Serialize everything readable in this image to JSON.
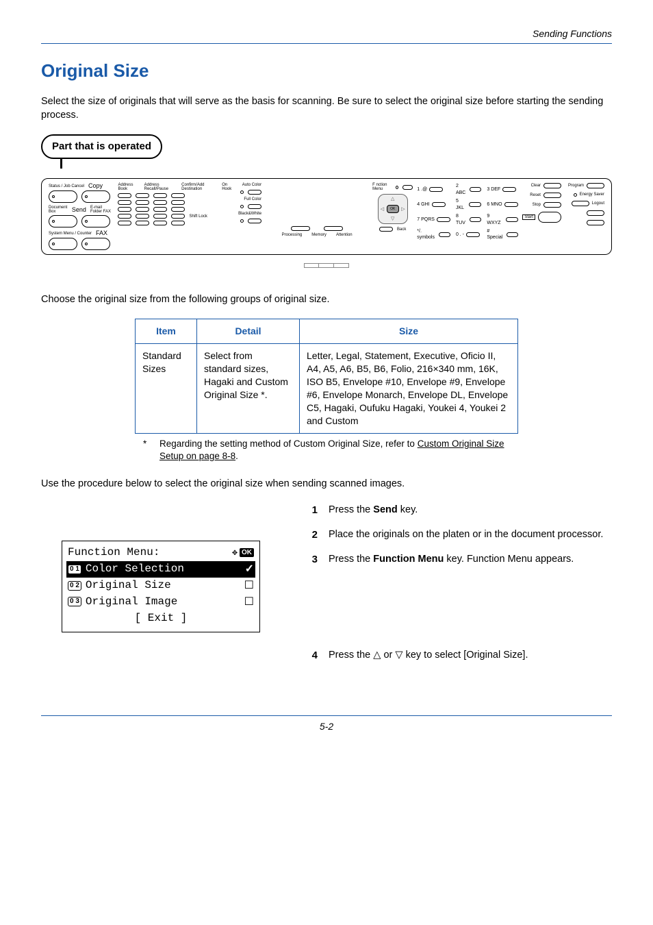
{
  "header": {
    "breadcrumb": "Sending Functions"
  },
  "title": "Original Size",
  "intro": "Select the size of originals that will serve as the basis for scanning. Be sure to select the original size before starting the sending process.",
  "pill_label": "Part that is operated",
  "panel": {
    "left_labels": {
      "status": "Status /\nJob Cancel",
      "copy": "Copy",
      "docbox": "Document\nBox",
      "send": "Send",
      "email_folder_fax": "E-mail\nFolder\nFAX",
      "sysmenu": "System Menu /\nCounter",
      "fax": "FAX"
    },
    "onetouch_header": [
      "Address\nBook",
      "Address\nRecall/Pause",
      "Confirm/Add\nDestination",
      "On Hook"
    ],
    "shift": "Shift Lock",
    "color_modes": [
      "Auto Color",
      "Full Color",
      "Black&White"
    ],
    "screen_labels": {
      "fn_menu": "F nction Menu",
      "back": "Back",
      "processing": "Processing",
      "memory": "Memory",
      "attention": "Attention"
    },
    "numpad": [
      "1 .@",
      "2 ABC",
      "3 DEF",
      "4 GHI",
      "5 JKL",
      "6 MNO",
      "7 PQRS",
      "8 TUV",
      "9 WXYZ",
      "*/. symbols",
      "0 . -",
      "# Special"
    ],
    "right": {
      "clear": "Clear",
      "reset": "Reset",
      "stop": "Stop",
      "start": "Start",
      "program": "Program",
      "logout": "Logout",
      "energy": "Energy\nSaver"
    }
  },
  "after_panel": "Choose the original size from the following groups of original size.",
  "table": {
    "headers": [
      "Item",
      "Detail",
      "Size"
    ],
    "row": {
      "item": "Standard Sizes",
      "detail": "Select from standard sizes, Hagaki and Custom Original Size *.",
      "size": "Letter, Legal, Statement, Executive, Oficio II, A4, A5, A6, B5, B6, Folio, 216×340 mm, 16K, ISO B5, Envelope #10, Envelope #9, Envelope #6, Envelope Monarch, Envelope DL, Envelope C5, Hagaki, Oufuku Hagaki, Youkei 4, Youkei 2 and Custom"
    }
  },
  "footnote": {
    "marker": "*",
    "lead": "Regarding the setting method of Custom Original Size, refer to ",
    "link": "Custom Original Size Setup on page 8-8",
    "tail": "."
  },
  "procedure_intro": "Use the procedure below to select the original size when sending scanned images.",
  "lcd": {
    "title": "Function Menu:",
    "items": [
      {
        "num": "0 1",
        "label": "Color Selection",
        "mark": "check",
        "selected": true
      },
      {
        "num": "0 2",
        "label": "Original Size",
        "mark": "square",
        "selected": false
      },
      {
        "num": "0 3",
        "label": "Original Image",
        "mark": "square",
        "selected": false
      }
    ],
    "exit": "[  Exit  ]"
  },
  "steps": [
    {
      "n": "1",
      "pre": "Press the ",
      "bold": "Send",
      "post": " key."
    },
    {
      "n": "2",
      "pre": "Place the originals on the platen or in the document processor.",
      "bold": "",
      "post": ""
    },
    {
      "n": "3",
      "pre": "Press the ",
      "bold": "Function Menu",
      "post": " key. Function Menu appears."
    },
    {
      "n": "4",
      "pre": "Press the ",
      "bold": "",
      "post": " key to select [Original Size].",
      "arrows": true
    }
  ],
  "page_number": "5-2"
}
